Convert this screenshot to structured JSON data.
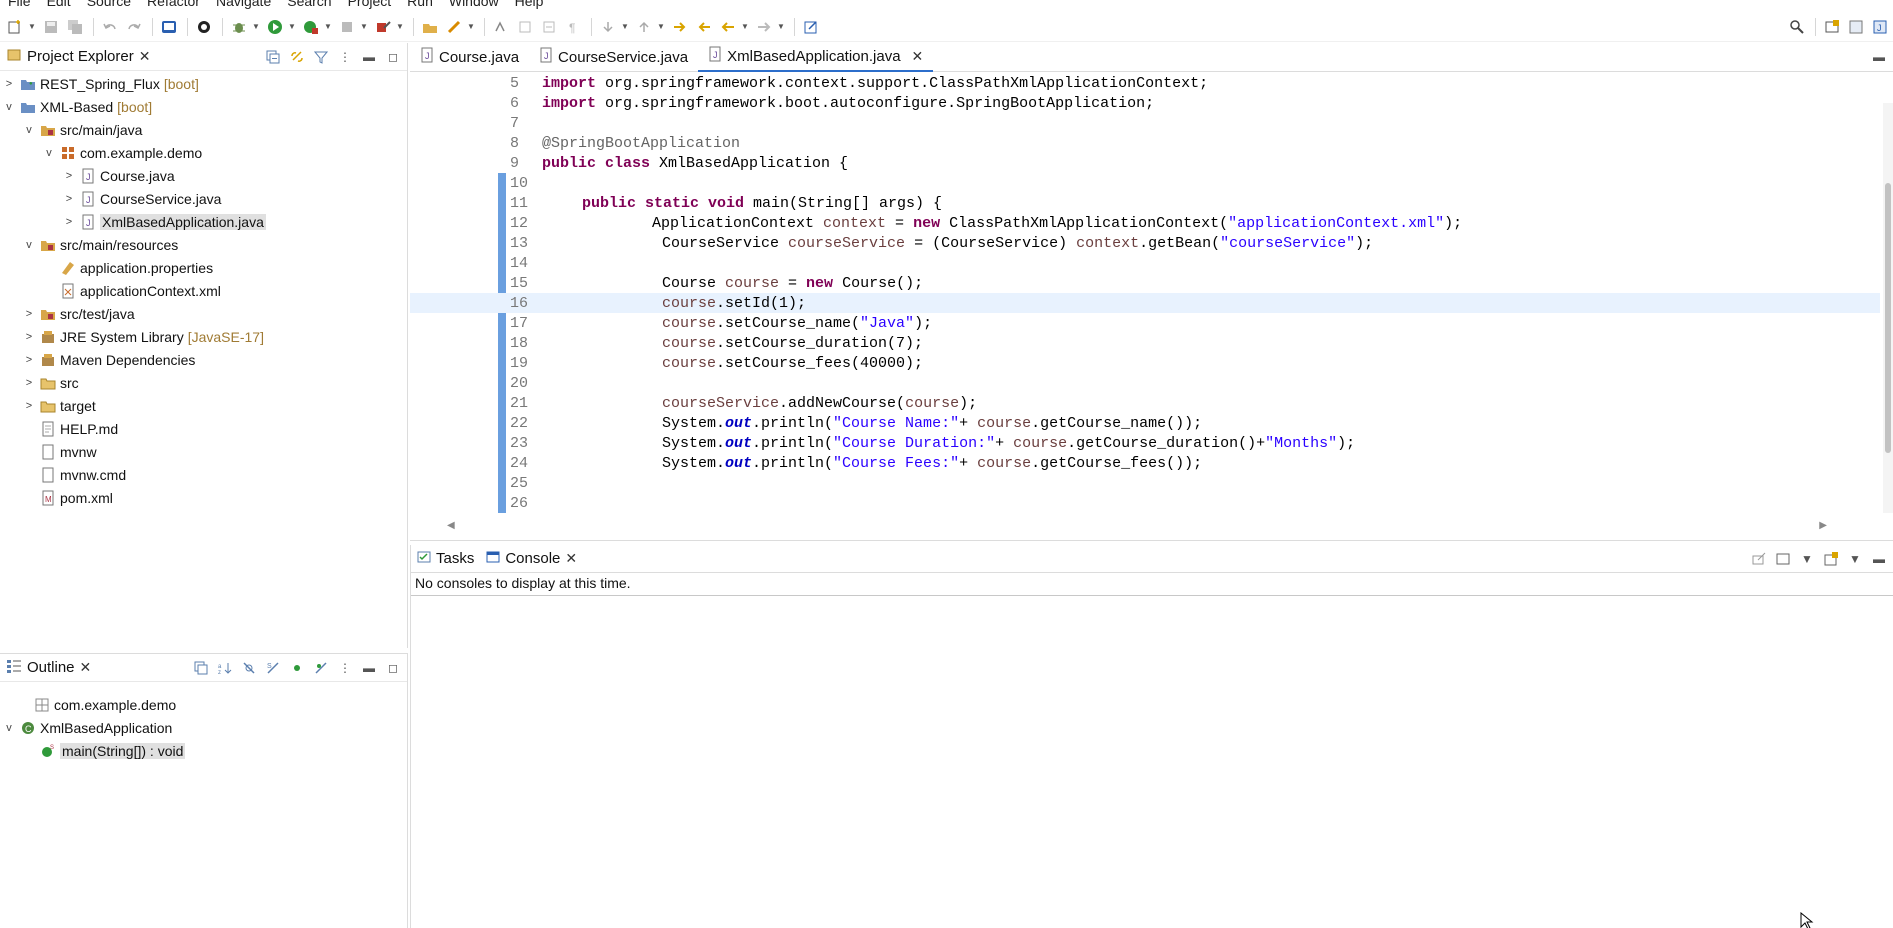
{
  "menu": [
    "File",
    "Edit",
    "Source",
    "Refactor",
    "Navigate",
    "Search",
    "Project",
    "Run",
    "Window",
    "Help"
  ],
  "project_explorer": {
    "title": "Project Explorer",
    "items": [
      {
        "label": "REST_Spring_Flux",
        "decoration": "[boot]",
        "twisty": ">",
        "icon": "project-icon"
      },
      {
        "label": "XML-Based",
        "decoration": "[boot]",
        "twisty": "v",
        "icon": "project-icon"
      },
      {
        "label": "src/main/java",
        "decoration": "",
        "twisty": "v",
        "icon": "source-folder-icon"
      },
      {
        "label": "com.example.demo",
        "decoration": "",
        "twisty": "v",
        "icon": "package-icon"
      },
      {
        "label": "Course.java",
        "decoration": "",
        "twisty": ">",
        "icon": "java-file-icon"
      },
      {
        "label": "CourseService.java",
        "decoration": "",
        "twisty": ">",
        "icon": "java-file-icon"
      },
      {
        "label": "XmlBasedApplication.java",
        "decoration": "",
        "twisty": ">",
        "icon": "java-file-icon"
      },
      {
        "label": "src/main/resources",
        "decoration": "",
        "twisty": "v",
        "icon": "source-folder-icon"
      },
      {
        "label": "application.properties",
        "decoration": "",
        "twisty": "",
        "icon": "properties-file-icon"
      },
      {
        "label": "applicationContext.xml",
        "decoration": "",
        "twisty": "",
        "icon": "xml-file-icon"
      },
      {
        "label": "src/test/java",
        "decoration": "",
        "twisty": ">",
        "icon": "source-folder-icon"
      },
      {
        "label": "JRE System Library",
        "decoration": "[JavaSE-17]",
        "twisty": ">",
        "icon": "library-icon"
      },
      {
        "label": "Maven Dependencies",
        "decoration": "",
        "twisty": ">",
        "icon": "library-icon"
      },
      {
        "label": "src",
        "decoration": "",
        "twisty": ">",
        "icon": "folder-icon"
      },
      {
        "label": "target",
        "decoration": "",
        "twisty": ">",
        "icon": "folder-icon"
      },
      {
        "label": "HELP.md",
        "decoration": "",
        "twisty": "",
        "icon": "file-icon"
      },
      {
        "label": "mvnw",
        "decoration": "",
        "twisty": "",
        "icon": "file-icon"
      },
      {
        "label": "mvnw.cmd",
        "decoration": "",
        "twisty": "",
        "icon": "file-icon"
      },
      {
        "label": "pom.xml",
        "decoration": "",
        "twisty": "",
        "icon": "maven-file-icon"
      }
    ]
  },
  "outline": {
    "title": "Outline",
    "items": [
      {
        "label": "com.example.demo",
        "twisty": "",
        "icon": "package-decl-icon"
      },
      {
        "label": "XmlBasedApplication",
        "twisty": "v",
        "icon": "class-icon"
      },
      {
        "label": "main(String[]) : void",
        "twisty": "",
        "icon": "method-icon"
      }
    ]
  },
  "editor": {
    "tabs": [
      {
        "label": "Course.java",
        "active": false
      },
      {
        "label": "CourseService.java",
        "active": false
      },
      {
        "label": "XmlBasedApplication.java",
        "active": true
      }
    ],
    "line_numbers": [
      "5",
      "6",
      "7",
      "8",
      "9",
      "10",
      "11",
      "12",
      "13",
      "14",
      "15",
      "16",
      "17",
      "18",
      "19",
      "20",
      "21",
      "22",
      "23",
      "24",
      "25",
      "26"
    ],
    "l5_kw": "import",
    "l5_rest": " org.springframework.context.support.ClassPathXmlApplicationContext;",
    "l6_kw": "import",
    "l6_rest": " org.springframework.boot.autoconfigure.SpringBootApplication;",
    "l8_ann": "@SpringBootApplication",
    "l9_kw": "public class",
    "l9_rest": " XmlBasedApplication {",
    "l11_kw": "public static void",
    "l11_rest": " main(String[] args) {",
    "l12_a": "ApplicationContext ",
    "l12_var": "context",
    "l12_b": " = ",
    "l12_kw": "new",
    "l12_c": " ClassPathXmlApplicationContext(",
    "l12_str": "\"applicationContext.xml\"",
    "l12_d": ");",
    "l13_a": "CourseService ",
    "l13_var": "courseService",
    "l13_b": " = (CourseService) ",
    "l13_var2": "context",
    "l13_c": ".getBean(",
    "l13_str": "\"courseService\"",
    "l13_d": ");",
    "l15_a": "Course ",
    "l15_var": "course",
    "l15_b": " = ",
    "l15_kw": "new",
    "l15_c": " Course();",
    "l16_var": "course",
    "l16_rest": ".setId(1);",
    "l17_var": "course",
    "l17_a": ".setCourse_name(",
    "l17_str": "\"Java\"",
    "l17_b": ");",
    "l18_var": "course",
    "l18_rest": ".setCourse_duration(7);",
    "l19_var": "course",
    "l19_rest": ".setCourse_fees(40000);",
    "l21_var": "courseService",
    "l21_a": ".addNewCourse(",
    "l21_var2": "course",
    "l21_b": ");",
    "l22_a": "System.",
    "l22_fld": "out",
    "l22_b": ".println(",
    "l22_str": "\"Course Name:\"",
    "l22_c": "+ ",
    "l22_var": "course",
    "l22_d": ".getCourse_name());",
    "l23_a": "System.",
    "l23_fld": "out",
    "l23_b": ".println(",
    "l23_str": "\"Course Duration:\"",
    "l23_c": "+ ",
    "l23_var": "course",
    "l23_d": ".getCourse_duration()+",
    "l23_str2": "\"Months\"",
    "l23_e": ");",
    "l24_a": "System.",
    "l24_fld": "out",
    "l24_b": ".println(",
    "l24_str": "\"Course Fees:\"",
    "l24_c": "+ ",
    "l24_var": "course",
    "l24_d": ".getCourse_fees());"
  },
  "bottom": {
    "tabs": [
      {
        "label": "Tasks"
      },
      {
        "label": "Console"
      }
    ],
    "console_message": "No consoles to display at this time."
  },
  "colors": {
    "keyword": "#7f0055",
    "string": "#2a00ff",
    "annotation": "#646464",
    "local_var": "#6a3e3e",
    "static_field": "#0000c0",
    "decoration": "#a07b34",
    "current_line": "#e8f2fe"
  }
}
